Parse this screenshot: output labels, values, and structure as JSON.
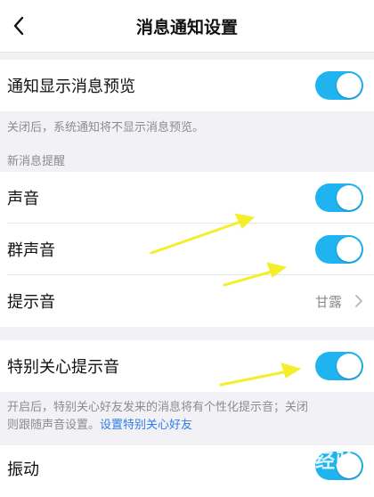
{
  "header": {
    "title": "消息通知设置",
    "back_icon": "back-chevron-icon"
  },
  "preview": {
    "label": "通知显示消息预览",
    "enabled": true,
    "note": "关闭后，系统通知将不显示消息预览。"
  },
  "new_message_section": {
    "label": "新消息提醒",
    "items": [
      {
        "label": "声音",
        "enabled": true
      },
      {
        "label": "群声音",
        "enabled": true
      }
    ],
    "tone": {
      "label": "提示音",
      "value": "甘露"
    }
  },
  "special_care": {
    "label": "特别关心提示音",
    "enabled": true,
    "note_line1": "开启后，特别关心好友发来的消息将有个性化提示音；关闭",
    "note_line2_prefix": "则跟随声音设置。",
    "note_link": "设置特别关心好友"
  },
  "vibrate": {
    "label": "振动",
    "enabled": true
  },
  "watermark_text": "Bai经验",
  "colors": {
    "accent": "#1fb4f0",
    "annotation": "#f5ee2a",
    "link": "#2f7de8"
  }
}
